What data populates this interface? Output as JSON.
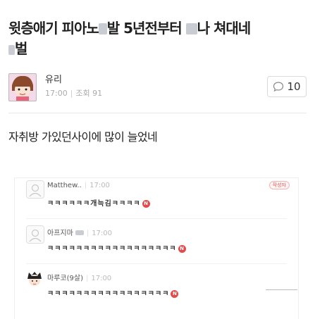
{
  "post": {
    "title_part1": "윗층애기 피아노",
    "title_part2": "발 5년전부터",
    "title_part3": "나 쳐대네",
    "title_part4": "벌"
  },
  "author": {
    "name": "유리",
    "time": "17:00",
    "views_label": "조회",
    "views": "91"
  },
  "comment_count": "10",
  "body": {
    "text": "자취방 가있던사이에 많이 늘었네"
  },
  "comments": [
    {
      "name": "Matthew..",
      "time": "17:00",
      "text": "ㅋㅋㅋㅋㅋㅋ개늑김ㅋㅋㅋㅋ",
      "badge": "N",
      "op_label": "작성자"
    },
    {
      "name": "아프지마",
      "time": "17:00",
      "text": "ㅋㅋㅋㅋㅋㅋㅋㅋㅋㅋㅋㅋㅋㅋㅋㅋㅋㅋ",
      "badge": "N"
    },
    {
      "name": "마루코(9살)",
      "time": "17:00",
      "text": "ㅋㅋㅋㅋㅋㅋㅋㅋㅋㅋㅋㅋㅋㅋㅋㅋㅋ",
      "badge": "N"
    }
  ],
  "colors": {
    "badge": "#e5494b",
    "redacted": "#c9ccd3"
  }
}
